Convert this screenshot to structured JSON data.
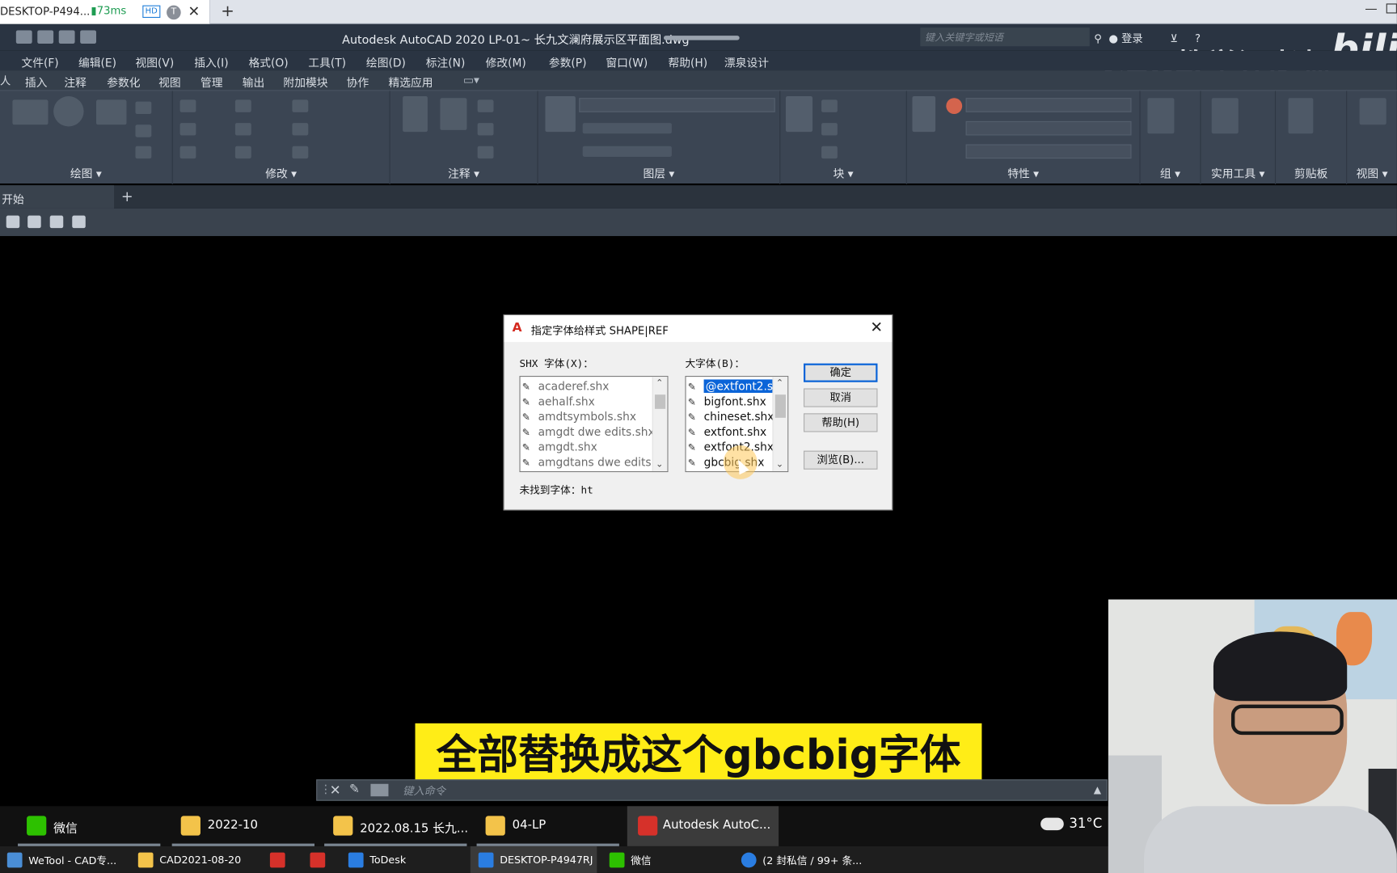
{
  "browser_tab": {
    "title": "DESKTOP-P494...",
    "ping": "73ms",
    "hd_badge": "HD",
    "t_badge": "T"
  },
  "acad": {
    "title": "Autodesk AutoCAD 2020   LP-01~ 长九文澜府展示区平面图.dwg",
    "search_placeholder": "键入关键字或短语",
    "login": "登录",
    "watermark": "CAD教学江老师",
    "bilibili_logo": "bili"
  },
  "menu": [
    "文件(F)",
    "编辑(E)",
    "视图(V)",
    "插入(I)",
    "格式(O)",
    "工具(T)",
    "绘图(D)",
    "标注(N)",
    "修改(M)",
    "参数(P)",
    "窗口(W)",
    "帮助(H)",
    "漂泉设计"
  ],
  "ribbon_tabs": [
    "插入",
    "注释",
    "参数化",
    "视图",
    "管理",
    "输出",
    "附加模块",
    "协作",
    "精选应用"
  ],
  "ribbon_sections": [
    "绘图",
    "修改",
    "注释",
    "图层",
    "块",
    "特性",
    "组",
    "实用工具",
    "剪贴板",
    "视图"
  ],
  "start_tab": "开始",
  "dialog": {
    "title": "指定字体给样式 SHAPE|REF",
    "shx_label": "SHX 字体(X)：",
    "big_label": "大字体(B)：",
    "shx_fonts": [
      "acaderef.shx",
      "aehalf.shx",
      "amdtsymbols.shx",
      "amgdt dwe edits.shx",
      "amgdt.shx",
      "amgdtans dwe edits."
    ],
    "big_fonts": [
      "@extfont2.s",
      "bigfont.shx",
      "chineset.shx",
      "extfont.shx",
      "extfont2.shx",
      "gbcbig.shx"
    ],
    "buttons": {
      "ok": "确定",
      "cancel": "取消",
      "help": "帮助(H)",
      "browse": "浏览(B)..."
    },
    "not_found": "未找到字体：ht"
  },
  "subtitle": "全部替换成这个gbcbig字体",
  "cmdline": {
    "placeholder": "键入命令"
  },
  "taskbar_top": [
    {
      "label": "微信",
      "color": "#2dc100"
    },
    {
      "label": "2022-10",
      "color": "#f3c34a"
    },
    {
      "label": "2022.08.15 长九...",
      "color": "#f3c34a"
    },
    {
      "label": "04-LP",
      "color": "#f3c34a"
    },
    {
      "label": "Autodesk AutoC...",
      "color": "#d6312a"
    }
  ],
  "weather": "31°C",
  "taskbar_bottom": [
    {
      "label": "WeTool - CAD专...",
      "color": "#4a8ed6"
    },
    {
      "label": "CAD2021-08-20",
      "color": "#f3c34a"
    },
    {
      "label": "",
      "color": "#d6312a"
    },
    {
      "label": "",
      "color": "#d6312a"
    },
    {
      "label": "ToDesk",
      "color": "#2a7de1"
    },
    {
      "label": "DESKTOP-P4947RJ",
      "color": "#2a7de1"
    },
    {
      "label": "微信",
      "color": "#2dc100"
    },
    {
      "label": "(2 封私信 / 99+ 条...",
      "color": "#2a7de1"
    }
  ]
}
